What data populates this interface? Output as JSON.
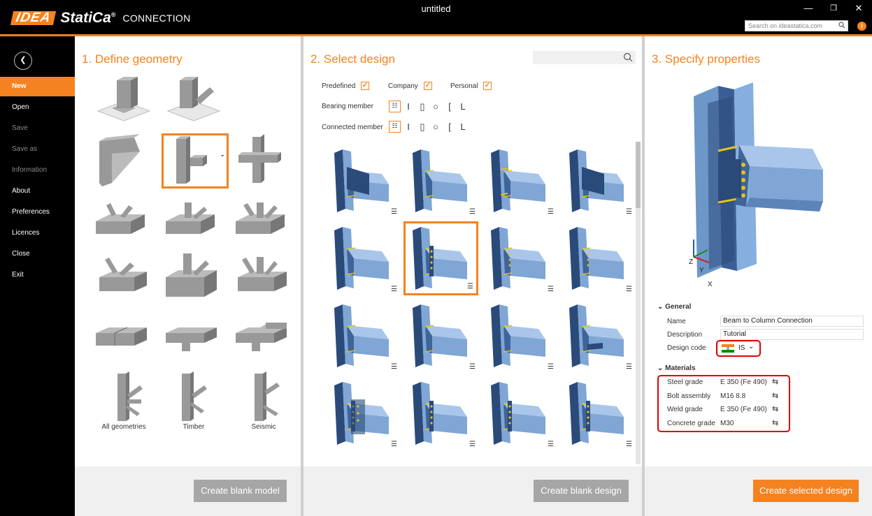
{
  "window": {
    "title": "untitled",
    "minimize": "—",
    "restore": "❐",
    "close": "✕"
  },
  "brand": {
    "idea": "IDEA",
    "statica": "StatiCa",
    "reg": "®",
    "product": "CONNECTION"
  },
  "search": {
    "placeholder": "Search on ideastatica.com"
  },
  "sidebar": {
    "back": "❮",
    "items": [
      {
        "label": "New"
      },
      {
        "label": "Open"
      },
      {
        "label": "Save"
      },
      {
        "label": "Save as"
      },
      {
        "label": "Information"
      },
      {
        "label": "About"
      },
      {
        "label": "Preferences"
      },
      {
        "label": "Licences"
      },
      {
        "label": "Close"
      },
      {
        "label": "Exit"
      }
    ]
  },
  "geometry": {
    "title": "1. Define geometry",
    "labels": {
      "all": "All geometries",
      "timber": "Timber",
      "seismic": "Seismic"
    },
    "create_button": "Create blank model"
  },
  "design": {
    "title": "2. Select design",
    "filters": {
      "predefined": "Predefined",
      "company": "Company",
      "personal": "Personal"
    },
    "bearing_member": "Bearing member",
    "connected_member": "Connected member",
    "create_button": "Create blank design"
  },
  "properties": {
    "title": "3. Specify properties",
    "general": "General",
    "name_label": "Name",
    "name_value": "Beam to Column Connection",
    "description_label": "Description",
    "description_value": "Tutorial",
    "design_code_label": "Design code",
    "design_code_value": "IS",
    "materials": "Materials",
    "steel_label": "Steel grade",
    "steel_value": "E 350 (Fe 490)",
    "bolt_label": "Bolt assembly",
    "bolt_value": "M16 8.8",
    "weld_label": "Weld grade",
    "weld_value": "E 350 (Fe 490)",
    "concrete_label": "Concrete grade",
    "concrete_value": "M30",
    "axes": {
      "z": "Z",
      "y": "Y",
      "x": "X"
    },
    "create_button": "Create selected design"
  },
  "colors": {
    "accent": "#f58220",
    "highlight": "#d00000",
    "steel": "#7fa6d4",
    "dark_steel": "#2a4a7a"
  }
}
